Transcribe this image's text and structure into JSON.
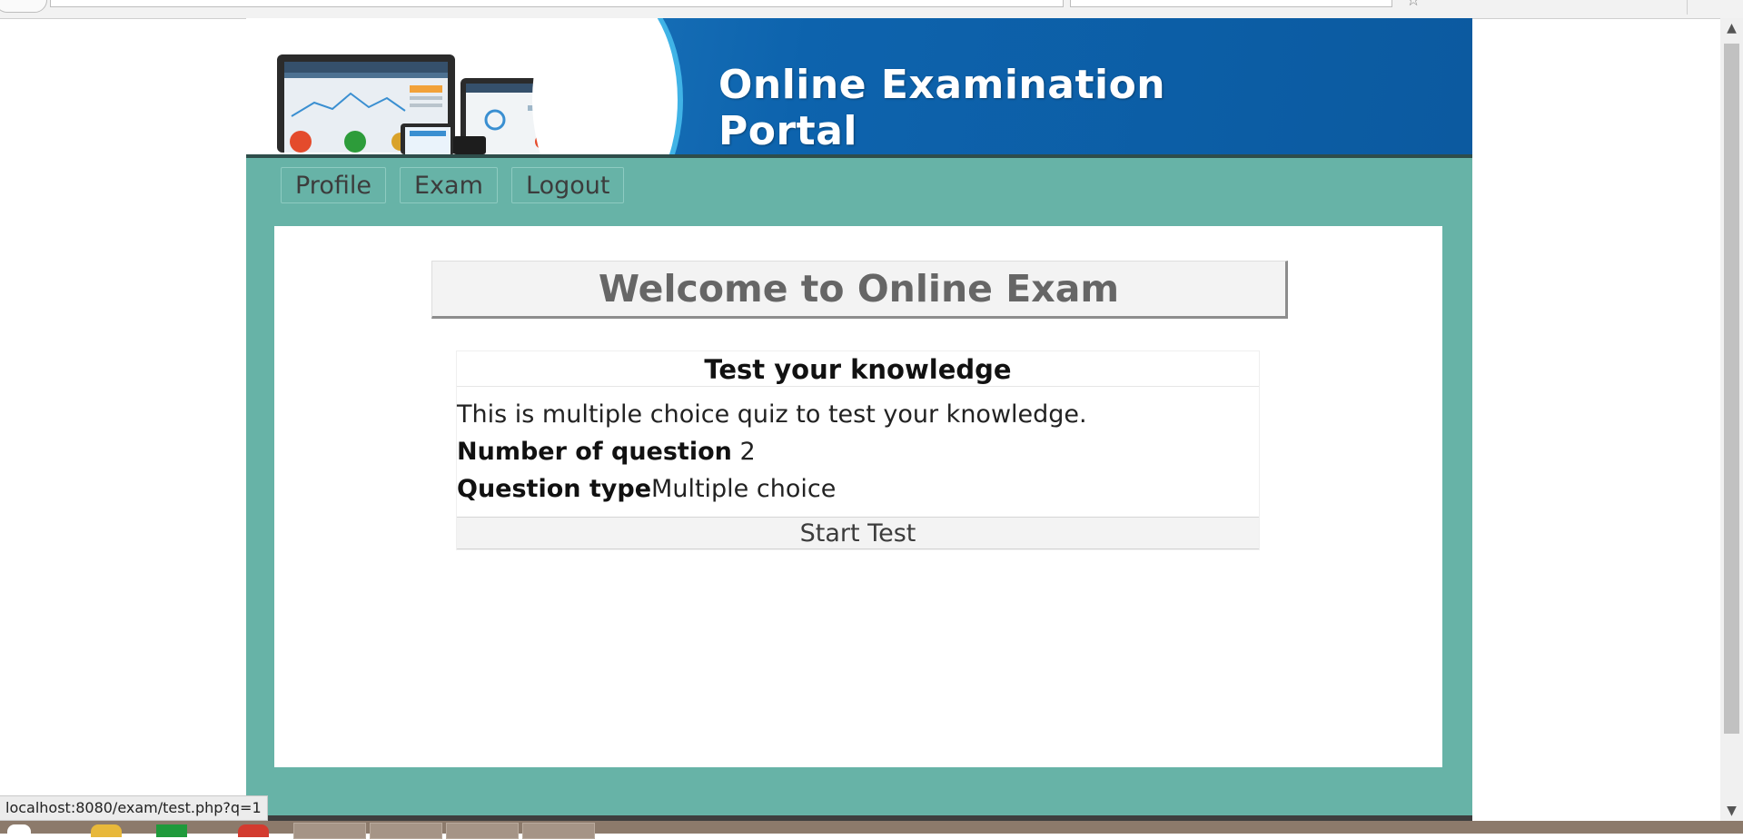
{
  "banner": {
    "title": "Online Examination Portal"
  },
  "nav": {
    "profile_label": "Profile",
    "exam_label": "Exam",
    "logout_label": "Logout"
  },
  "main": {
    "welcome_heading": "Welcome to Online Exam",
    "quiz": {
      "title": "Test your knowledge",
      "description": "This is multiple choice quiz to test your knowledge.",
      "question_count_label": "Number of question",
      "question_count_value": "2",
      "question_type_label": "Question type",
      "question_type_value": "Multiple choice",
      "start_button_label": "Start Test"
    }
  },
  "status_bar": {
    "hover_url": "localhost:8080/exam/test.php?q=1"
  },
  "colors": {
    "page_bg": "#67b3a7",
    "banner_blue": "#0d63ad",
    "content_bg": "#ffffff",
    "heading_gray": "#666666"
  },
  "icons": {
    "scroll_up": "scroll-up-arrow-icon",
    "scroll_down": "scroll-down-arrow-icon"
  }
}
